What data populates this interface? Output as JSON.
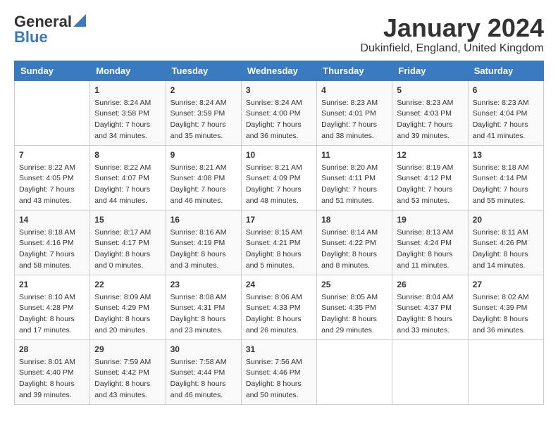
{
  "logo": {
    "general": "General",
    "blue": "Blue"
  },
  "title": "January 2024",
  "location": "Dukinfield, England, United Kingdom",
  "days_header": [
    "Sunday",
    "Monday",
    "Tuesday",
    "Wednesday",
    "Thursday",
    "Friday",
    "Saturday"
  ],
  "weeks": [
    [
      {
        "day": "",
        "sunrise": "",
        "sunset": "",
        "daylight": ""
      },
      {
        "day": "1",
        "sunrise": "Sunrise: 8:24 AM",
        "sunset": "Sunset: 3:58 PM",
        "daylight": "Daylight: 7 hours and 34 minutes."
      },
      {
        "day": "2",
        "sunrise": "Sunrise: 8:24 AM",
        "sunset": "Sunset: 3:59 PM",
        "daylight": "Daylight: 7 hours and 35 minutes."
      },
      {
        "day": "3",
        "sunrise": "Sunrise: 8:24 AM",
        "sunset": "Sunset: 4:00 PM",
        "daylight": "Daylight: 7 hours and 36 minutes."
      },
      {
        "day": "4",
        "sunrise": "Sunrise: 8:23 AM",
        "sunset": "Sunset: 4:01 PM",
        "daylight": "Daylight: 7 hours and 38 minutes."
      },
      {
        "day": "5",
        "sunrise": "Sunrise: 8:23 AM",
        "sunset": "Sunset: 4:03 PM",
        "daylight": "Daylight: 7 hours and 39 minutes."
      },
      {
        "day": "6",
        "sunrise": "Sunrise: 8:23 AM",
        "sunset": "Sunset: 4:04 PM",
        "daylight": "Daylight: 7 hours and 41 minutes."
      }
    ],
    [
      {
        "day": "7",
        "sunrise": "Sunrise: 8:22 AM",
        "sunset": "Sunset: 4:05 PM",
        "daylight": "Daylight: 7 hours and 43 minutes."
      },
      {
        "day": "8",
        "sunrise": "Sunrise: 8:22 AM",
        "sunset": "Sunset: 4:07 PM",
        "daylight": "Daylight: 7 hours and 44 minutes."
      },
      {
        "day": "9",
        "sunrise": "Sunrise: 8:21 AM",
        "sunset": "Sunset: 4:08 PM",
        "daylight": "Daylight: 7 hours and 46 minutes."
      },
      {
        "day": "10",
        "sunrise": "Sunrise: 8:21 AM",
        "sunset": "Sunset: 4:09 PM",
        "daylight": "Daylight: 7 hours and 48 minutes."
      },
      {
        "day": "11",
        "sunrise": "Sunrise: 8:20 AM",
        "sunset": "Sunset: 4:11 PM",
        "daylight": "Daylight: 7 hours and 51 minutes."
      },
      {
        "day": "12",
        "sunrise": "Sunrise: 8:19 AM",
        "sunset": "Sunset: 4:12 PM",
        "daylight": "Daylight: 7 hours and 53 minutes."
      },
      {
        "day": "13",
        "sunrise": "Sunrise: 8:18 AM",
        "sunset": "Sunset: 4:14 PM",
        "daylight": "Daylight: 7 hours and 55 minutes."
      }
    ],
    [
      {
        "day": "14",
        "sunrise": "Sunrise: 8:18 AM",
        "sunset": "Sunset: 4:16 PM",
        "daylight": "Daylight: 7 hours and 58 minutes."
      },
      {
        "day": "15",
        "sunrise": "Sunrise: 8:17 AM",
        "sunset": "Sunset: 4:17 PM",
        "daylight": "Daylight: 8 hours and 0 minutes."
      },
      {
        "day": "16",
        "sunrise": "Sunrise: 8:16 AM",
        "sunset": "Sunset: 4:19 PM",
        "daylight": "Daylight: 8 hours and 3 minutes."
      },
      {
        "day": "17",
        "sunrise": "Sunrise: 8:15 AM",
        "sunset": "Sunset: 4:21 PM",
        "daylight": "Daylight: 8 hours and 5 minutes."
      },
      {
        "day": "18",
        "sunrise": "Sunrise: 8:14 AM",
        "sunset": "Sunset: 4:22 PM",
        "daylight": "Daylight: 8 hours and 8 minutes."
      },
      {
        "day": "19",
        "sunrise": "Sunrise: 8:13 AM",
        "sunset": "Sunset: 4:24 PM",
        "daylight": "Daylight: 8 hours and 11 minutes."
      },
      {
        "day": "20",
        "sunrise": "Sunrise: 8:11 AM",
        "sunset": "Sunset: 4:26 PM",
        "daylight": "Daylight: 8 hours and 14 minutes."
      }
    ],
    [
      {
        "day": "21",
        "sunrise": "Sunrise: 8:10 AM",
        "sunset": "Sunset: 4:28 PM",
        "daylight": "Daylight: 8 hours and 17 minutes."
      },
      {
        "day": "22",
        "sunrise": "Sunrise: 8:09 AM",
        "sunset": "Sunset: 4:29 PM",
        "daylight": "Daylight: 8 hours and 20 minutes."
      },
      {
        "day": "23",
        "sunrise": "Sunrise: 8:08 AM",
        "sunset": "Sunset: 4:31 PM",
        "daylight": "Daylight: 8 hours and 23 minutes."
      },
      {
        "day": "24",
        "sunrise": "Sunrise: 8:06 AM",
        "sunset": "Sunset: 4:33 PM",
        "daylight": "Daylight: 8 hours and 26 minutes."
      },
      {
        "day": "25",
        "sunrise": "Sunrise: 8:05 AM",
        "sunset": "Sunset: 4:35 PM",
        "daylight": "Daylight: 8 hours and 29 minutes."
      },
      {
        "day": "26",
        "sunrise": "Sunrise: 8:04 AM",
        "sunset": "Sunset: 4:37 PM",
        "daylight": "Daylight: 8 hours and 33 minutes."
      },
      {
        "day": "27",
        "sunrise": "Sunrise: 8:02 AM",
        "sunset": "Sunset: 4:39 PM",
        "daylight": "Daylight: 8 hours and 36 minutes."
      }
    ],
    [
      {
        "day": "28",
        "sunrise": "Sunrise: 8:01 AM",
        "sunset": "Sunset: 4:40 PM",
        "daylight": "Daylight: 8 hours and 39 minutes."
      },
      {
        "day": "29",
        "sunrise": "Sunrise: 7:59 AM",
        "sunset": "Sunset: 4:42 PM",
        "daylight": "Daylight: 8 hours and 43 minutes."
      },
      {
        "day": "30",
        "sunrise": "Sunrise: 7:58 AM",
        "sunset": "Sunset: 4:44 PM",
        "daylight": "Daylight: 8 hours and 46 minutes."
      },
      {
        "day": "31",
        "sunrise": "Sunrise: 7:56 AM",
        "sunset": "Sunset: 4:46 PM",
        "daylight": "Daylight: 8 hours and 50 minutes."
      },
      {
        "day": "",
        "sunrise": "",
        "sunset": "",
        "daylight": ""
      },
      {
        "day": "",
        "sunrise": "",
        "sunset": "",
        "daylight": ""
      },
      {
        "day": "",
        "sunrise": "",
        "sunset": "",
        "daylight": ""
      }
    ]
  ]
}
